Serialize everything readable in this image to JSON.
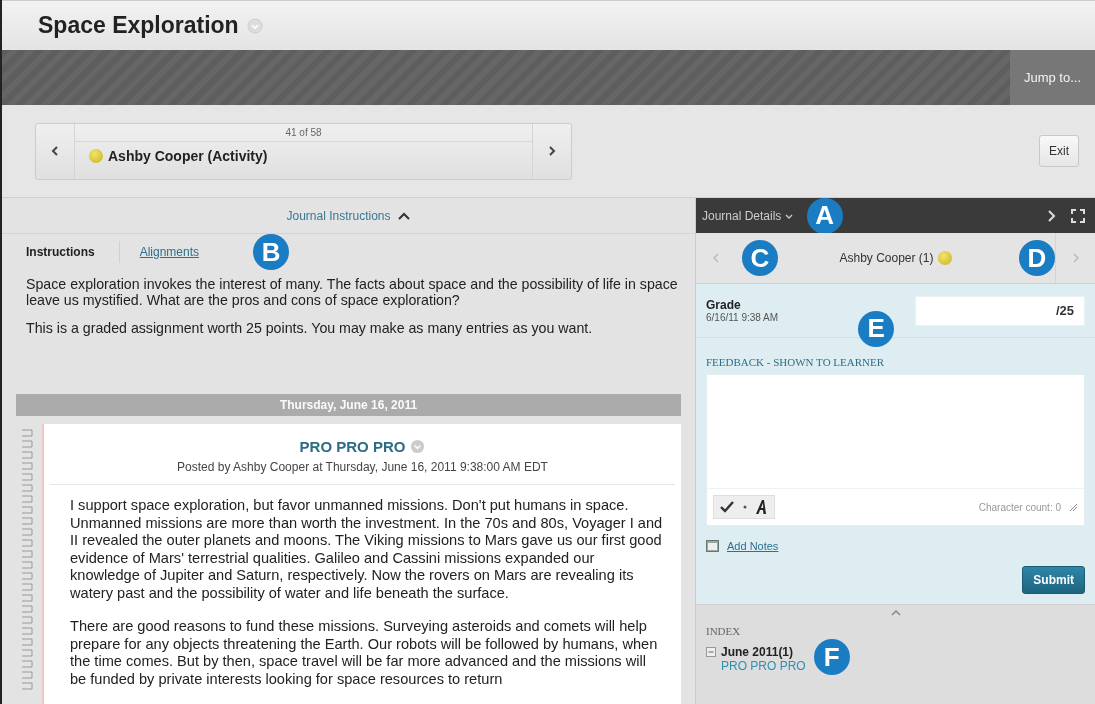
{
  "page_title": "Space Exploration",
  "jump_button": "Jump to...",
  "navigator": {
    "position": "41 of 58",
    "student": "Ashby Cooper (Activity)"
  },
  "exit_button": "Exit",
  "instructions": {
    "header": "Journal Instructions",
    "expanded": true,
    "callout": "B",
    "tabs": [
      {
        "label": "Instructions",
        "selected": true
      },
      {
        "label": "Alignments",
        "selected": false
      }
    ],
    "paragraphs": [
      "Space exploration invokes the interest of many. The facts about space and the possibility of life in space leave us mystified. What are the pros and cons of space exploration?",
      "This is a graded assignment worth 25 points. You may make as many entries as you want."
    ]
  },
  "date_bar": "Thursday, June 16, 2011",
  "entry": {
    "title": "PRO PRO PRO",
    "posted_by": "Posted by Ashby Cooper at Thursday, June 16, 2011 9:38:00 AM EDT",
    "paragraphs": [
      "I support space exploration, but favor unmanned missions. Don't put humans in space. Unmanned missions are more than worth the investment. In the 70s and 80s, Voyager I and II revealed the outer planets and moons. The Viking missions to Mars gave us our first good evidence of Mars' terrestrial qualities. Galileo and Cassini missions expanded our knowledge of Jupiter and Saturn, respectively. Now the rovers on Mars are revealing its watery past and the possibility of water and life beneath the surface.",
      "There are good reasons to fund these missions. Surveying asteroids and comets will help prepare for any objects threatening the Earth. Our robots will be followed by humans, when the time comes. But by then, space travel will be far more advanced and the missions will be funded by private interests looking for space resources to return"
    ]
  },
  "details": {
    "title": "Journal Details",
    "callout": "A",
    "student": "Ashby Cooper (1)",
    "student_callouts": [
      "C",
      "D"
    ],
    "grade": {
      "label": "Grade",
      "date": "6/16/11 9:38 AM",
      "suffix": "/25",
      "callout": "E"
    },
    "feedback": {
      "label": "FEEDBACK - SHOWN TO LEARNER",
      "character_count": "Character count: 0"
    },
    "add_notes": "Add Notes",
    "submit": "Submit"
  },
  "index": {
    "label": "INDEX",
    "callout": "F",
    "groups": [
      {
        "label": "June 2011(1)",
        "expanded": true,
        "children": [
          {
            "label": "PRO PRO PRO"
          }
        ]
      }
    ]
  }
}
